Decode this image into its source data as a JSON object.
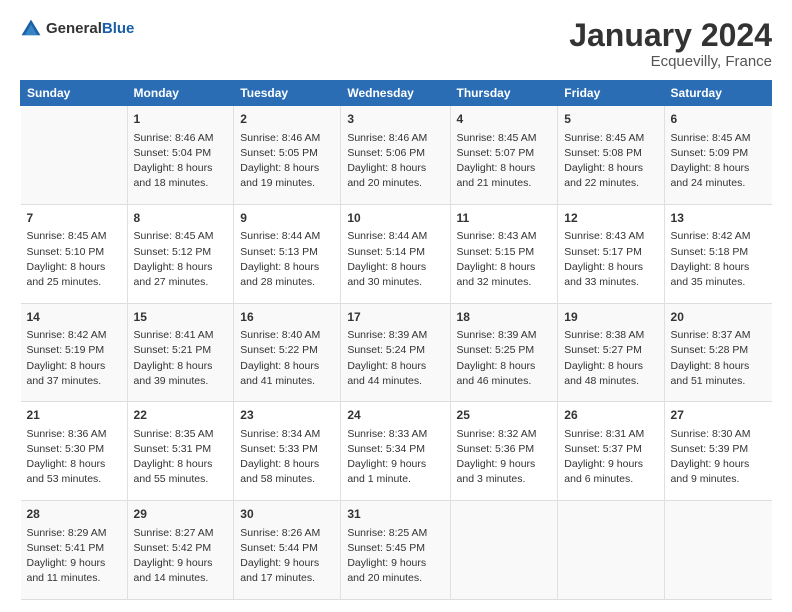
{
  "header": {
    "logo_general": "General",
    "logo_blue": "Blue",
    "title": "January 2024",
    "subtitle": "Ecquevilly, France"
  },
  "calendar": {
    "days_of_week": [
      "Sunday",
      "Monday",
      "Tuesday",
      "Wednesday",
      "Thursday",
      "Friday",
      "Saturday"
    ],
    "weeks": [
      [
        {
          "day": "",
          "sunrise": "",
          "sunset": "",
          "daylight": ""
        },
        {
          "day": "1",
          "sunrise": "Sunrise: 8:46 AM",
          "sunset": "Sunset: 5:04 PM",
          "daylight": "Daylight: 8 hours and 18 minutes."
        },
        {
          "day": "2",
          "sunrise": "Sunrise: 8:46 AM",
          "sunset": "Sunset: 5:05 PM",
          "daylight": "Daylight: 8 hours and 19 minutes."
        },
        {
          "day": "3",
          "sunrise": "Sunrise: 8:46 AM",
          "sunset": "Sunset: 5:06 PM",
          "daylight": "Daylight: 8 hours and 20 minutes."
        },
        {
          "day": "4",
          "sunrise": "Sunrise: 8:45 AM",
          "sunset": "Sunset: 5:07 PM",
          "daylight": "Daylight: 8 hours and 21 minutes."
        },
        {
          "day": "5",
          "sunrise": "Sunrise: 8:45 AM",
          "sunset": "Sunset: 5:08 PM",
          "daylight": "Daylight: 8 hours and 22 minutes."
        },
        {
          "day": "6",
          "sunrise": "Sunrise: 8:45 AM",
          "sunset": "Sunset: 5:09 PM",
          "daylight": "Daylight: 8 hours and 24 minutes."
        }
      ],
      [
        {
          "day": "7",
          "sunrise": "Sunrise: 8:45 AM",
          "sunset": "Sunset: 5:10 PM",
          "daylight": "Daylight: 8 hours and 25 minutes."
        },
        {
          "day": "8",
          "sunrise": "Sunrise: 8:45 AM",
          "sunset": "Sunset: 5:12 PM",
          "daylight": "Daylight: 8 hours and 27 minutes."
        },
        {
          "day": "9",
          "sunrise": "Sunrise: 8:44 AM",
          "sunset": "Sunset: 5:13 PM",
          "daylight": "Daylight: 8 hours and 28 minutes."
        },
        {
          "day": "10",
          "sunrise": "Sunrise: 8:44 AM",
          "sunset": "Sunset: 5:14 PM",
          "daylight": "Daylight: 8 hours and 30 minutes."
        },
        {
          "day": "11",
          "sunrise": "Sunrise: 8:43 AM",
          "sunset": "Sunset: 5:15 PM",
          "daylight": "Daylight: 8 hours and 32 minutes."
        },
        {
          "day": "12",
          "sunrise": "Sunrise: 8:43 AM",
          "sunset": "Sunset: 5:17 PM",
          "daylight": "Daylight: 8 hours and 33 minutes."
        },
        {
          "day": "13",
          "sunrise": "Sunrise: 8:42 AM",
          "sunset": "Sunset: 5:18 PM",
          "daylight": "Daylight: 8 hours and 35 minutes."
        }
      ],
      [
        {
          "day": "14",
          "sunrise": "Sunrise: 8:42 AM",
          "sunset": "Sunset: 5:19 PM",
          "daylight": "Daylight: 8 hours and 37 minutes."
        },
        {
          "day": "15",
          "sunrise": "Sunrise: 8:41 AM",
          "sunset": "Sunset: 5:21 PM",
          "daylight": "Daylight: 8 hours and 39 minutes."
        },
        {
          "day": "16",
          "sunrise": "Sunrise: 8:40 AM",
          "sunset": "Sunset: 5:22 PM",
          "daylight": "Daylight: 8 hours and 41 minutes."
        },
        {
          "day": "17",
          "sunrise": "Sunrise: 8:39 AM",
          "sunset": "Sunset: 5:24 PM",
          "daylight": "Daylight: 8 hours and 44 minutes."
        },
        {
          "day": "18",
          "sunrise": "Sunrise: 8:39 AM",
          "sunset": "Sunset: 5:25 PM",
          "daylight": "Daylight: 8 hours and 46 minutes."
        },
        {
          "day": "19",
          "sunrise": "Sunrise: 8:38 AM",
          "sunset": "Sunset: 5:27 PM",
          "daylight": "Daylight: 8 hours and 48 minutes."
        },
        {
          "day": "20",
          "sunrise": "Sunrise: 8:37 AM",
          "sunset": "Sunset: 5:28 PM",
          "daylight": "Daylight: 8 hours and 51 minutes."
        }
      ],
      [
        {
          "day": "21",
          "sunrise": "Sunrise: 8:36 AM",
          "sunset": "Sunset: 5:30 PM",
          "daylight": "Daylight: 8 hours and 53 minutes."
        },
        {
          "day": "22",
          "sunrise": "Sunrise: 8:35 AM",
          "sunset": "Sunset: 5:31 PM",
          "daylight": "Daylight: 8 hours and 55 minutes."
        },
        {
          "day": "23",
          "sunrise": "Sunrise: 8:34 AM",
          "sunset": "Sunset: 5:33 PM",
          "daylight": "Daylight: 8 hours and 58 minutes."
        },
        {
          "day": "24",
          "sunrise": "Sunrise: 8:33 AM",
          "sunset": "Sunset: 5:34 PM",
          "daylight": "Daylight: 9 hours and 1 minute."
        },
        {
          "day": "25",
          "sunrise": "Sunrise: 8:32 AM",
          "sunset": "Sunset: 5:36 PM",
          "daylight": "Daylight: 9 hours and 3 minutes."
        },
        {
          "day": "26",
          "sunrise": "Sunrise: 8:31 AM",
          "sunset": "Sunset: 5:37 PM",
          "daylight": "Daylight: 9 hours and 6 minutes."
        },
        {
          "day": "27",
          "sunrise": "Sunrise: 8:30 AM",
          "sunset": "Sunset: 5:39 PM",
          "daylight": "Daylight: 9 hours and 9 minutes."
        }
      ],
      [
        {
          "day": "28",
          "sunrise": "Sunrise: 8:29 AM",
          "sunset": "Sunset: 5:41 PM",
          "daylight": "Daylight: 9 hours and 11 minutes."
        },
        {
          "day": "29",
          "sunrise": "Sunrise: 8:27 AM",
          "sunset": "Sunset: 5:42 PM",
          "daylight": "Daylight: 9 hours and 14 minutes."
        },
        {
          "day": "30",
          "sunrise": "Sunrise: 8:26 AM",
          "sunset": "Sunset: 5:44 PM",
          "daylight": "Daylight: 9 hours and 17 minutes."
        },
        {
          "day": "31",
          "sunrise": "Sunrise: 8:25 AM",
          "sunset": "Sunset: 5:45 PM",
          "daylight": "Daylight: 9 hours and 20 minutes."
        },
        {
          "day": "",
          "sunrise": "",
          "sunset": "",
          "daylight": ""
        },
        {
          "day": "",
          "sunrise": "",
          "sunset": "",
          "daylight": ""
        },
        {
          "day": "",
          "sunrise": "",
          "sunset": "",
          "daylight": ""
        }
      ]
    ]
  }
}
